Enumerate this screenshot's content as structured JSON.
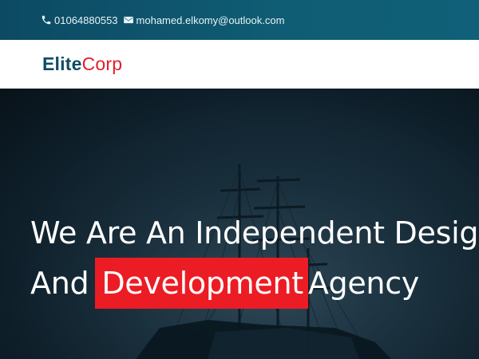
{
  "topbar": {
    "phone": "01064880553",
    "email": "mohamed.elkomy@outlook.com",
    "phone_icon": "phone-icon",
    "email_icon": "envelope-icon"
  },
  "brand": {
    "part1": "Elite",
    "part2": "Corp",
    "color_primary": "#0d4b64",
    "color_accent": "#e01f2a"
  },
  "hero": {
    "line1": "We Are An Independent Design",
    "line2_start": "And",
    "line2_highlight": "Development",
    "line2_end": "Agency",
    "highlight_color": "#ec1c24",
    "background": "dark sailing ship image"
  }
}
